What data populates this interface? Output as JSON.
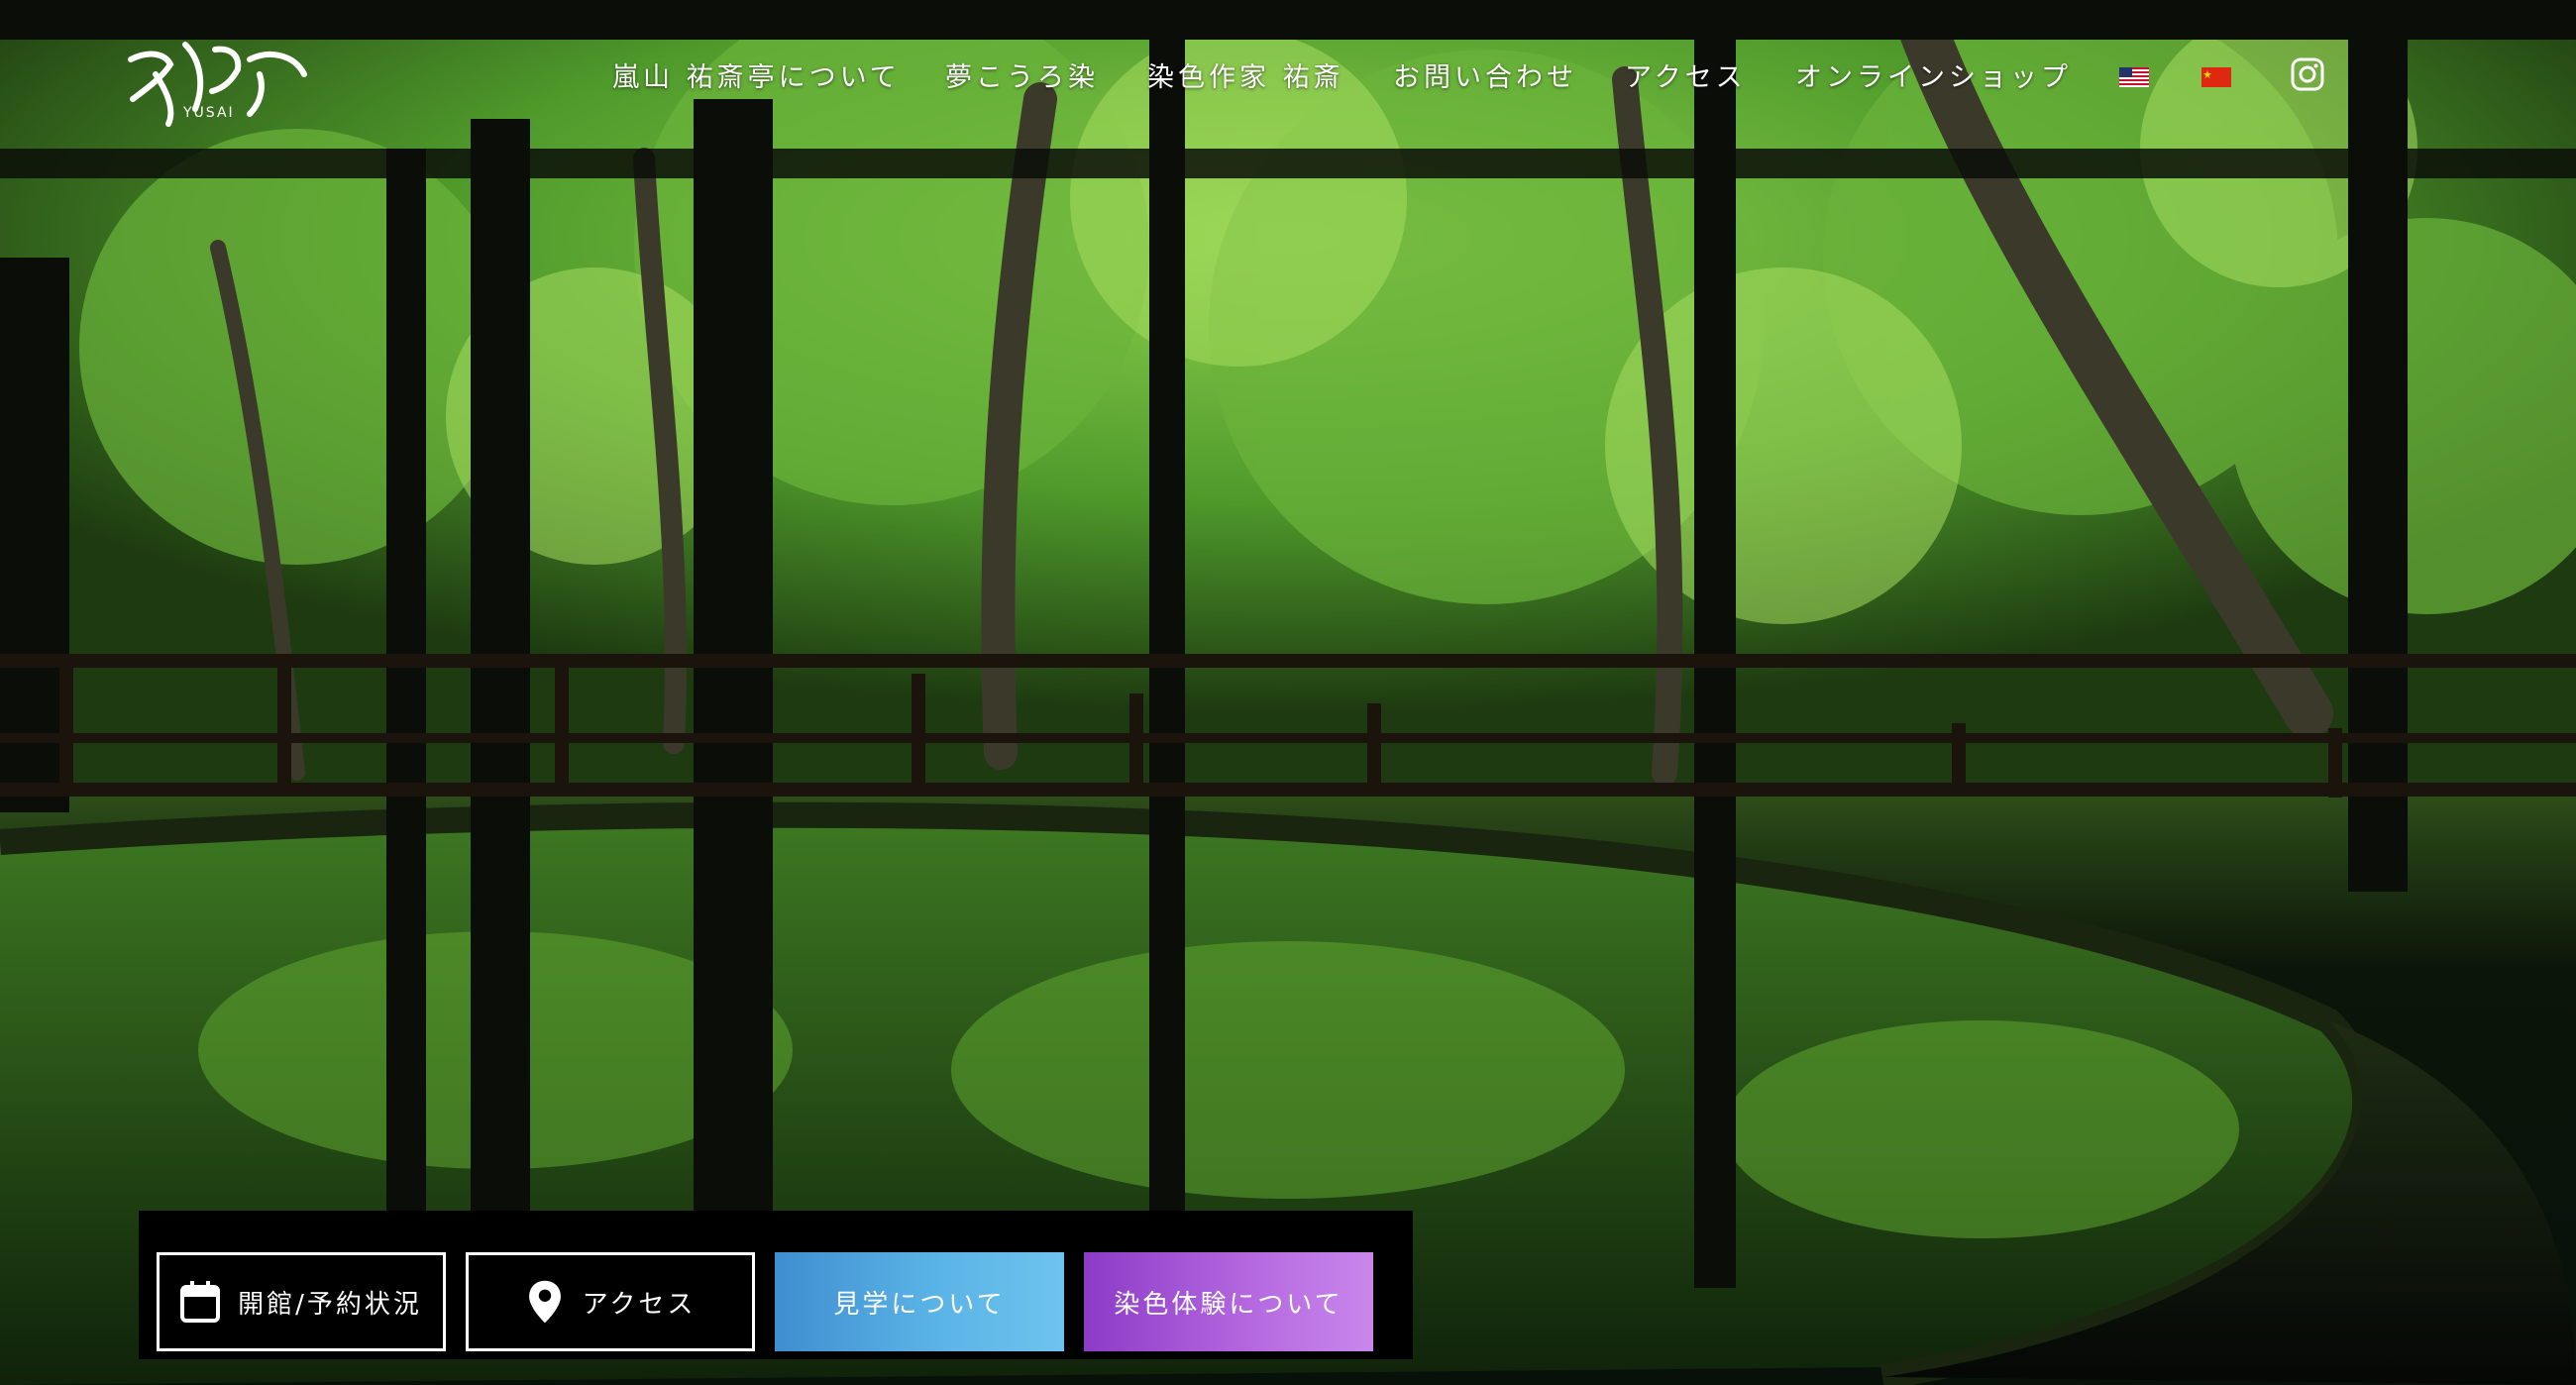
{
  "header": {
    "logo_alt": "YUSAI",
    "logo_sub": "YUSAI",
    "nav": [
      {
        "label": "嵐山 祐斎亭について"
      },
      {
        "label": "夢こうろ染"
      },
      {
        "label": "染色作家 祐斎"
      },
      {
        "label": "お問い合わせ"
      },
      {
        "label": "アクセス"
      },
      {
        "label": "オンラインショップ"
      }
    ],
    "languages": [
      "en-us-flag-icon",
      "zh-cn-flag-icon"
    ],
    "social": "instagram-icon"
  },
  "hero": {
    "description_icon": "forest-window-reflection-photo"
  },
  "actions": [
    {
      "label": "開館/予約状況",
      "icon": "calendar-icon"
    },
    {
      "label": "アクセス",
      "icon": "map-pin-icon"
    },
    {
      "label": "見学について"
    },
    {
      "label": "染色体験について"
    }
  ],
  "colors": {
    "tour_gradient": "#4aa3dc",
    "dye_gradient": "#a25ad6",
    "background": "#000000"
  }
}
